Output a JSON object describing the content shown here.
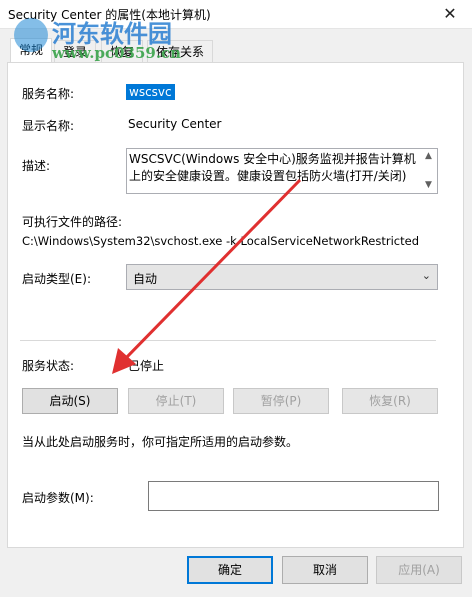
{
  "window": {
    "title": "Security Center 的属性(本地计算机)",
    "close_glyph": "✕"
  },
  "tabs": [
    {
      "label": "常规",
      "active": true
    },
    {
      "label": "登录",
      "active": false
    },
    {
      "label": "恢复",
      "active": false
    },
    {
      "label": "依存关系",
      "active": false
    }
  ],
  "fields": {
    "service_name_label": "服务名称:",
    "service_name_value": "wscsvc",
    "display_name_label": "显示名称:",
    "display_name_value": "Security Center",
    "description_label": "描述:",
    "description_value": "WSCSVC(Windows 安全中心)服务监视并报告计算机上的安全健康设置。健康设置包括防火墙(打开/关闭)",
    "exe_path_label": "可执行文件的路径:",
    "exe_path_value": "C:\\Windows\\System32\\svchost.exe -k LocalServiceNetworkRestricted",
    "startup_type_label": "启动类型(E):",
    "startup_type_value": "自动"
  },
  "status": {
    "label": "服务状态:",
    "value": "已停止"
  },
  "service_buttons": {
    "start": "启动(S)",
    "stop": "停止(T)",
    "pause": "暂停(P)",
    "resume": "恢复(R)"
  },
  "hint_text": "当从此处启动服务时，你可指定所适用的启动参数。",
  "start_params_label": "启动参数(M):",
  "start_params_value": "",
  "dialog_buttons": {
    "ok": "确定",
    "cancel": "取消",
    "apply": "应用(A)"
  },
  "watermark": {
    "title": "河东软件园",
    "url": "www.pc0359.cn"
  },
  "colors": {
    "selection": "#0078d7",
    "arrow": "#e03030"
  },
  "icons": {
    "close": "close-icon",
    "chevron": "chevron-down-icon",
    "scroll_up": "scroll-up-icon",
    "scroll_down": "scroll-down-icon"
  }
}
